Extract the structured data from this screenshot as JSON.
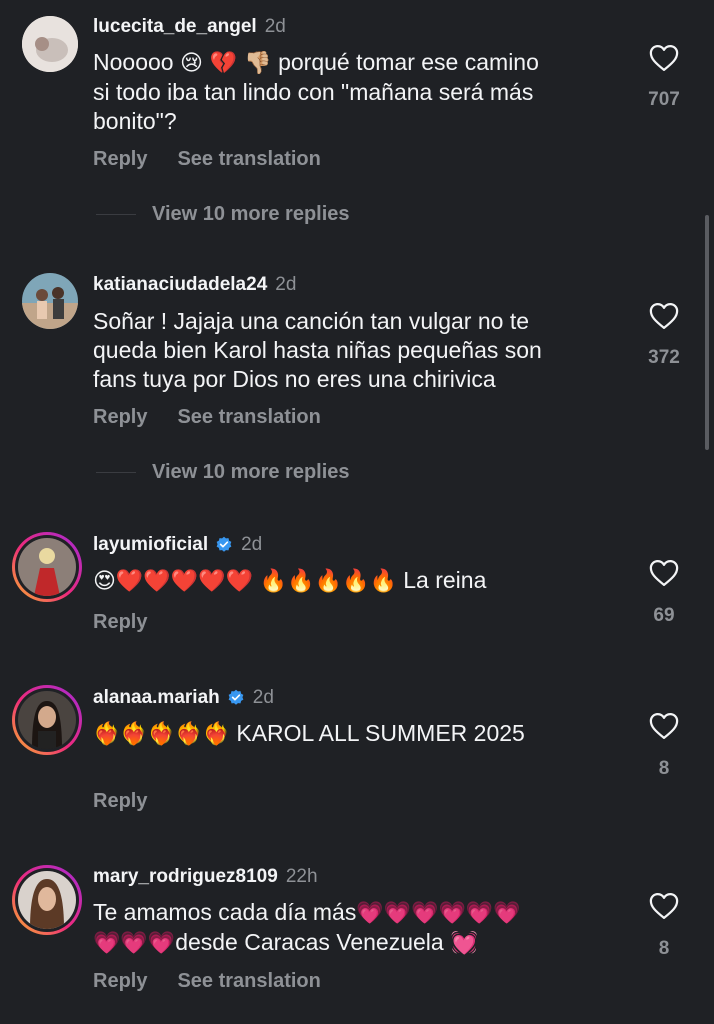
{
  "comments": [
    {
      "username": "lucecita_de_angel",
      "time": "2d",
      "verified": false,
      "text_line1": "Nooooo ",
      "text_line1_emojis": "😢 💔 👎🏼",
      "text_line1_tail": " porqué tomar ese camino",
      "text_line2": "si todo iba tan lindo con \"mañana será más",
      "text_line3": "bonito\"?",
      "likes": "707",
      "reply_label": "Reply",
      "translate_label": "See translation",
      "view_replies": "View 10 more replies"
    },
    {
      "username": "katianaciudadela24",
      "time": "2d",
      "verified": false,
      "text_line1": "Soñar ! Jajaja una canción tan vulgar no te",
      "text_line2": "queda bien Karol hasta niñas pequeñas son",
      "text_line3": "fans tuya por Dios no eres una chirivica",
      "likes": "372",
      "reply_label": "Reply",
      "translate_label": "See translation",
      "view_replies": "View 10 more replies"
    },
    {
      "username": "layumioficial",
      "time": "2d",
      "verified": true,
      "emojis": "😍❤️❤️❤️❤️❤️ 🔥🔥🔥🔥🔥",
      "text_tail": "La reina",
      "likes": "69",
      "reply_label": "Reply"
    },
    {
      "username": "alanaa.mariah",
      "time": "2d",
      "verified": true,
      "emojis": "❤️‍🔥❤️‍🔥❤️‍🔥❤️‍🔥❤️‍🔥",
      "text_tail": "KAROL ALL SUMMER 2025",
      "likes": "8",
      "reply_label": "Reply"
    },
    {
      "username": "mary_rodriguez8109",
      "time": "22h",
      "verified": false,
      "text_line1": "Te amamos cada día más",
      "text_line1_emojis": "💗💗💗💗💗💗",
      "text_line2_emojis": "💗💗💗",
      "text_line2": "desde Caracas Venezuela",
      "text_line2_tail": " 💓",
      "likes": "8",
      "reply_label": "Reply",
      "translate_label": "See translation"
    }
  ],
  "icons": {
    "heart": "heart-outline-icon",
    "verified": "verified-badge-icon"
  },
  "colors": {
    "background": "#1f2125",
    "text": "#f3f4f6",
    "muted": "#8e9196",
    "verified": "#3897f0"
  }
}
